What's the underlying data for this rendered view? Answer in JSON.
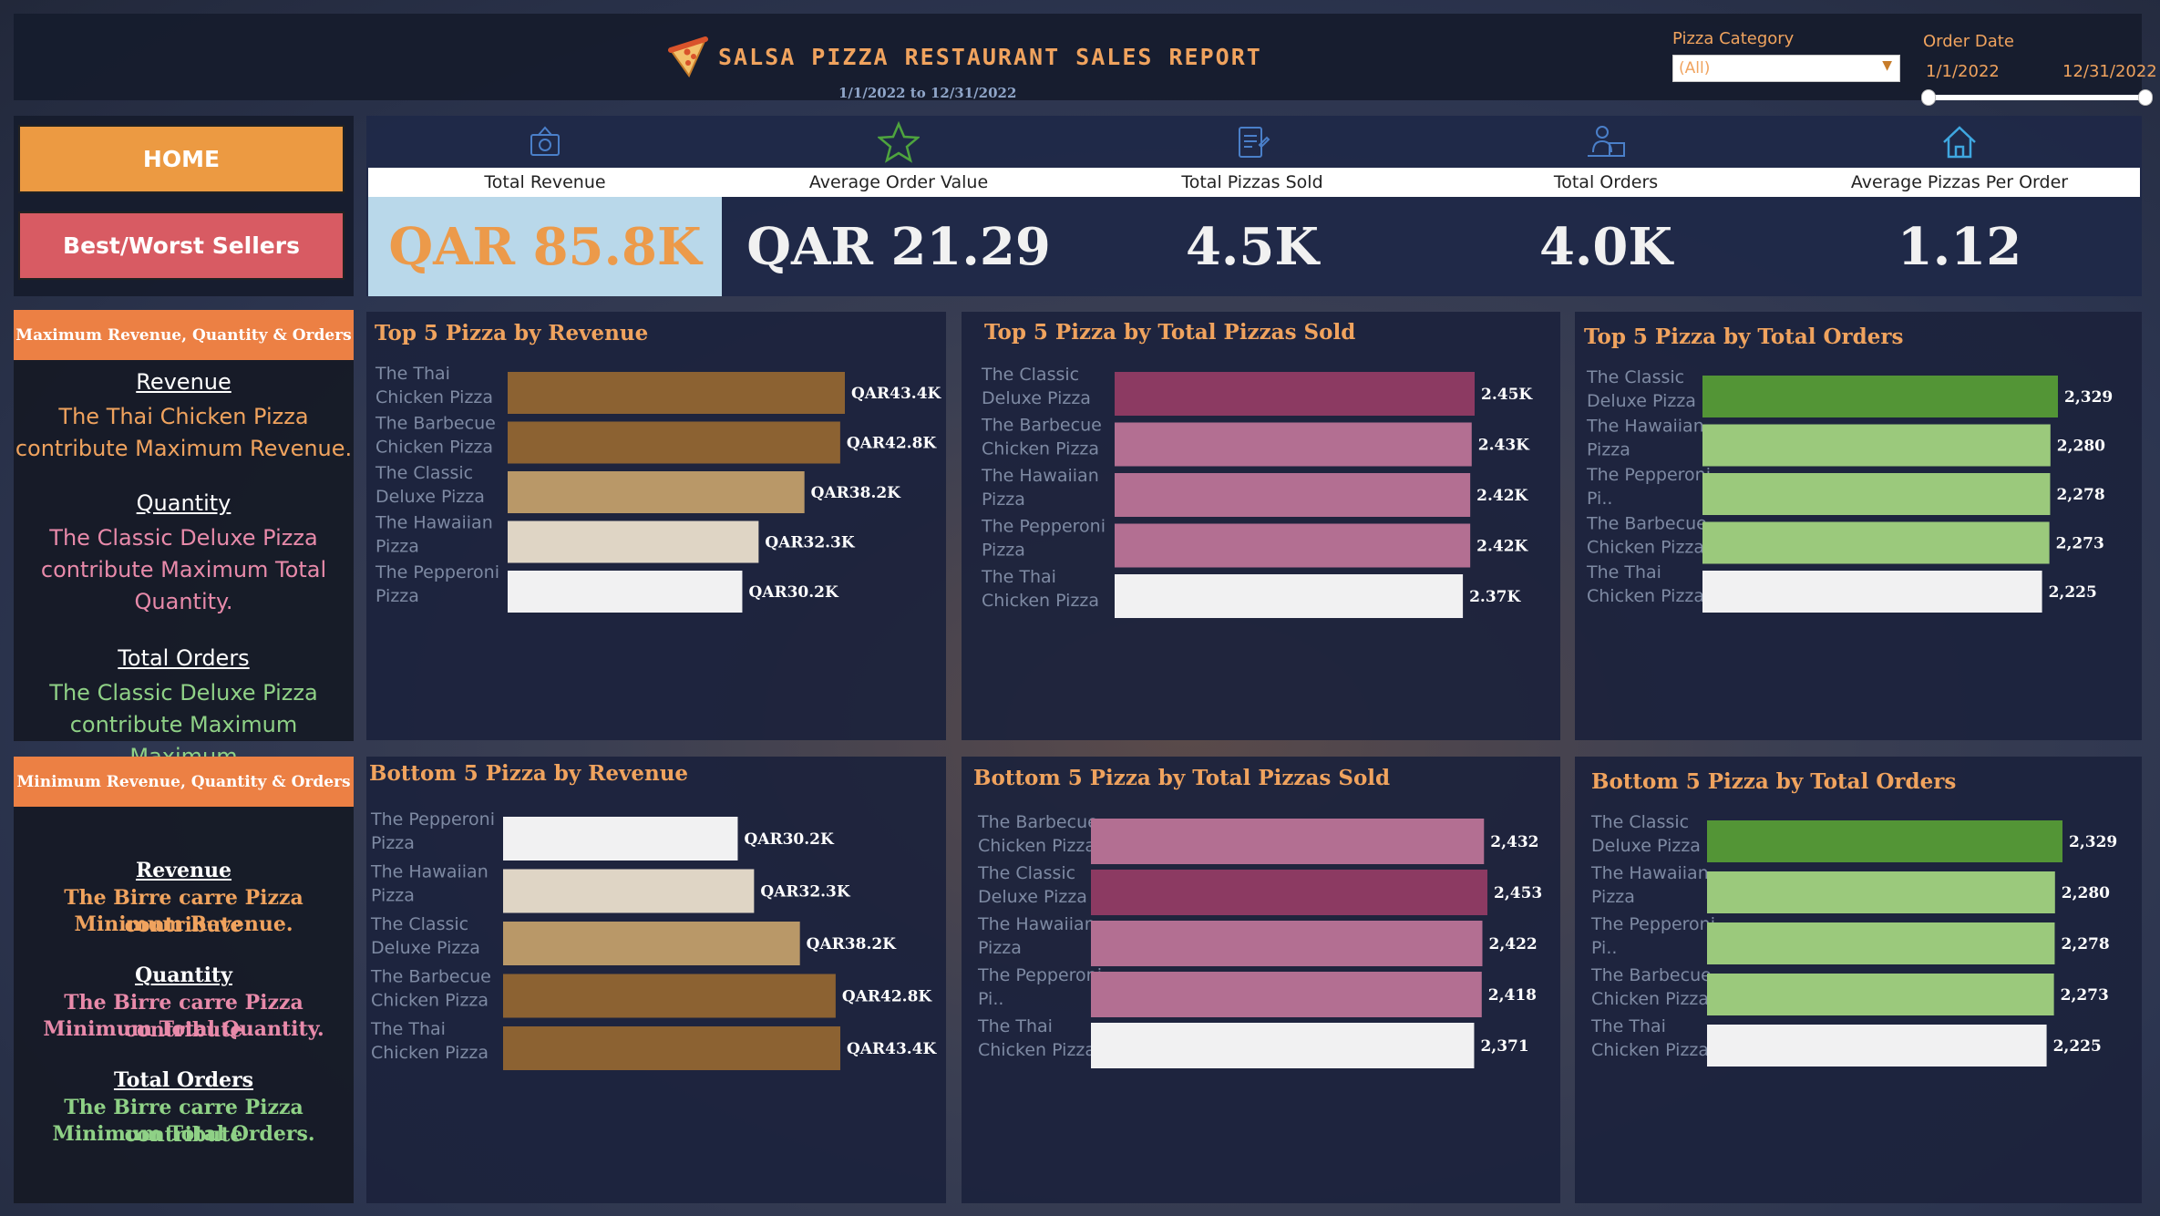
{
  "header": {
    "title": "SALSA PIZZA RESTAURANT SALES REPORT",
    "subtitle": "1/1/2022 to 12/31/2022",
    "pizza_category_label": "Pizza Category",
    "pizza_category_value": "(All)",
    "order_date_label": "Order Date",
    "date_start": "1/1/2022",
    "date_end": "12/31/2022"
  },
  "nav": {
    "home": "HOME",
    "best_worst": "Best/Worst Sellers"
  },
  "max_box": {
    "heading": "Maximum Revenue, Quantity & Orders",
    "revenue_h": "Revenue",
    "revenue_t1": "The Thai Chicken Pizza",
    "revenue_t2": "contribute Maximum Revenue.",
    "quantity_h": "Quantity",
    "quantity_t1": "The Classic Deluxe Pizza",
    "quantity_t2": "contribute Maximum Total",
    "quantity_t3": "Quantity.",
    "orders_h": "Total Orders",
    "orders_t1": "The Classic Deluxe Pizza",
    "orders_t2": "contribute Maximum Maximum"
  },
  "min_box": {
    "heading": "Minimum Revenue, Quantity & Orders",
    "revenue_h": "Revenue",
    "revenue_t1": "The Birre carre Pizza contribute",
    "revenue_t2": "Minimum Revenue.",
    "quantity_h": "Quantity",
    "quantity_t1": "The Birre carre Pizza contribute",
    "quantity_t2": "Minimum Total Quantity.",
    "orders_h": "Total Orders",
    "orders_t1": "The Birre carre  Pizza contribute",
    "orders_t2": "Minimum Total Orders."
  },
  "kpis": [
    {
      "label": "Total Revenue",
      "value": "QAR 85.8K",
      "icon": "money-icon"
    },
    {
      "label": "Average Order Value",
      "value": "QAR 21.29",
      "icon": "star-icon"
    },
    {
      "label": "Total Pizzas Sold",
      "value": "4.5K",
      "icon": "clipboard-icon"
    },
    {
      "label": "Total Orders",
      "value": "4.0K",
      "icon": "delivery-icon"
    },
    {
      "label": "Average Pizzas Per Order",
      "value": "1.12",
      "icon": "home-icon"
    }
  ],
  "colors": {
    "accent": "#f0a35e",
    "rev_dark": "#8c6232",
    "rev_mid": "#b99868",
    "rev_light": "#dfd5c5",
    "sold_dark": "#8c3a62",
    "sold_mid": "#b36f92",
    "ord_dark": "#539536",
    "ord_light": "#9bc97c",
    "white_bar": "#f1f1f2"
  },
  "chart_data": [
    {
      "type": "bar",
      "title": "Top 5 Pizza by Revenue",
      "categories": [
        "The Thai Chicken Pizza",
        "The Barbecue Chicken Pizza",
        "The Classic Deluxe Pizza",
        "The Hawaiian Pizza",
        "The Pepperoni Pizza"
      ],
      "values": [
        43.4,
        42.8,
        38.2,
        32.3,
        30.2
      ],
      "data_labels": [
        "QAR43.4K",
        "QAR42.8K",
        "QAR38.2K",
        "QAR32.3K",
        "QAR30.2K"
      ],
      "bar_colors": [
        "#8c6232",
        "#8c6232",
        "#b99868",
        "#dfd5c5",
        "#f1f1f2"
      ]
    },
    {
      "type": "bar",
      "title": "Top 5 Pizza by Total Pizzas Sold",
      "categories": [
        "The Classic Deluxe Pizza",
        "The Barbecue Chicken Pizza",
        "The Hawaiian Pizza",
        "The Pepperoni Pizza",
        "The Thai Chicken Pizza"
      ],
      "values": [
        2.45,
        2.43,
        2.42,
        2.42,
        2.37
      ],
      "data_labels": [
        "2.45K",
        "2.43K",
        "2.42K",
        "2.42K",
        "2.37K"
      ],
      "bar_colors": [
        "#8c3a62",
        "#b36f92",
        "#b36f92",
        "#b36f92",
        "#f1f1f2"
      ]
    },
    {
      "type": "bar",
      "title": "Top 5 Pizza by Total Orders",
      "categories": [
        "The Classic Deluxe Pizza",
        "The Hawaiian Pizza",
        "The Pepperoni Pi..",
        "The Barbecue Chicken Pizza",
        "The Thai Chicken Pizza"
      ],
      "values": [
        2329,
        2280,
        2278,
        2273,
        2225
      ],
      "data_labels": [
        "2,329",
        "2,280",
        "2,278",
        "2,273",
        "2,225"
      ],
      "bar_colors": [
        "#539536",
        "#9bc97c",
        "#9bc97c",
        "#9bc97c",
        "#f1f1f2"
      ]
    },
    {
      "type": "bar",
      "title": "Bottom 5 Pizza by Revenue",
      "categories": [
        "The Pepperoni Pizza",
        "The Hawaiian Pizza",
        "The Classic Deluxe Pizza",
        "The Barbecue Chicken Pizza",
        "The Thai Chicken Pizza"
      ],
      "values": [
        30.2,
        32.3,
        38.2,
        42.8,
        43.4
      ],
      "data_labels": [
        "QAR30.2K",
        "QAR32.3K",
        "QAR38.2K",
        "QAR42.8K",
        "QAR43.4K"
      ],
      "bar_colors": [
        "#f1f1f2",
        "#dfd5c5",
        "#b99868",
        "#8c6232",
        "#8c6232"
      ]
    },
    {
      "type": "bar",
      "title": "Bottom 5 Pizza by Total Pizzas Sold",
      "categories": [
        "The Barbecue Chicken Pizza",
        "The Classic Deluxe Pizza",
        "The Hawaiian Pizza",
        "The Pepperoni Pi..",
        "The Thai Chicken Pizza"
      ],
      "values": [
        2432,
        2453,
        2422,
        2418,
        2371
      ],
      "data_labels": [
        "2,432",
        "2,453",
        "2,422",
        "2,418",
        "2,371"
      ],
      "bar_colors": [
        "#b36f92",
        "#8c3a62",
        "#b36f92",
        "#b36f92",
        "#f1f1f2"
      ]
    },
    {
      "type": "bar",
      "title": "Bottom 5 Pizza by Total Orders",
      "categories": [
        "The Classic Deluxe Pizza",
        "The Hawaiian Pizza",
        "The Pepperoni Pi..",
        "The Barbecue Chicken Pizza",
        "The Thai Chicken Pizza"
      ],
      "values": [
        2329,
        2280,
        2278,
        2273,
        2225
      ],
      "data_labels": [
        "2,329",
        "2,280",
        "2,278",
        "2,273",
        "2,225"
      ],
      "bar_colors": [
        "#539536",
        "#9bc97c",
        "#9bc97c",
        "#9bc97c",
        "#f1f1f2"
      ]
    }
  ]
}
